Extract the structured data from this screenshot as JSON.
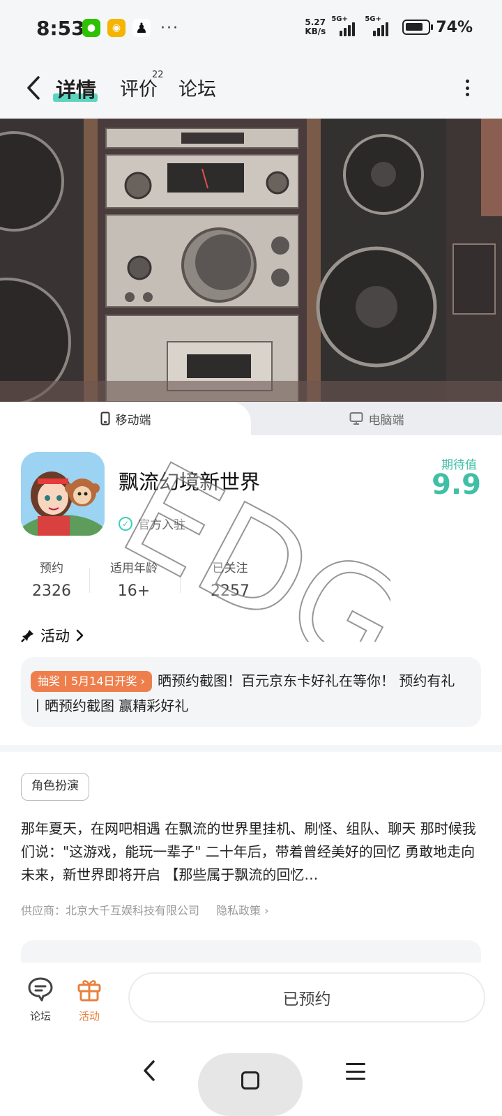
{
  "status": {
    "time": "8:53",
    "net_speed_top": "5.27",
    "net_speed_bottom": "KB/s",
    "sim1": "5G+",
    "sim2": "5G+",
    "battery": "74%",
    "more": "···"
  },
  "topnav": {
    "tabs": [
      {
        "label": "详情",
        "active": true
      },
      {
        "label": "评价",
        "count": "22"
      },
      {
        "label": "论坛"
      }
    ]
  },
  "platform": {
    "mobile": "移动端",
    "pc": "电脑端"
  },
  "app": {
    "name": "飘流幻境新世界",
    "official": "官方入驻",
    "expect_label": "期待值",
    "expect_value": "9.9"
  },
  "stats": [
    {
      "label": "预约",
      "value": "2326"
    },
    {
      "label": "适用年龄",
      "value": "16+"
    },
    {
      "label": "已关注",
      "value": "2257"
    }
  ],
  "activity": {
    "title": "活动",
    "badge": "抽奖丨5月14日开奖",
    "text": "晒预约截图！百元京东卡好礼在等你！ 预约有礼丨晒预约截图 赢精彩好礼"
  },
  "genre": "角色扮演",
  "description": "那年夏天，在网吧相遇 在飘流的世界里挂机、刷怪、组队、聊天 那时候我们说：\"这游戏，能玩一辈子\" 二十年后，带着曾经美好的回忆 勇敢地走向未来，新世界即将开启 【那些属于飘流的回忆…",
  "supplier": {
    "label": "供应商：北京大千互娱科技有限公司",
    "privacy": "隐私政策"
  },
  "bottom": {
    "forum": "论坛",
    "activity": "活动",
    "reserve": "已预约"
  },
  "watermark": "EDG",
  "colors": {
    "accent": "#3fcfb6",
    "orange": "#ee7f4d"
  }
}
